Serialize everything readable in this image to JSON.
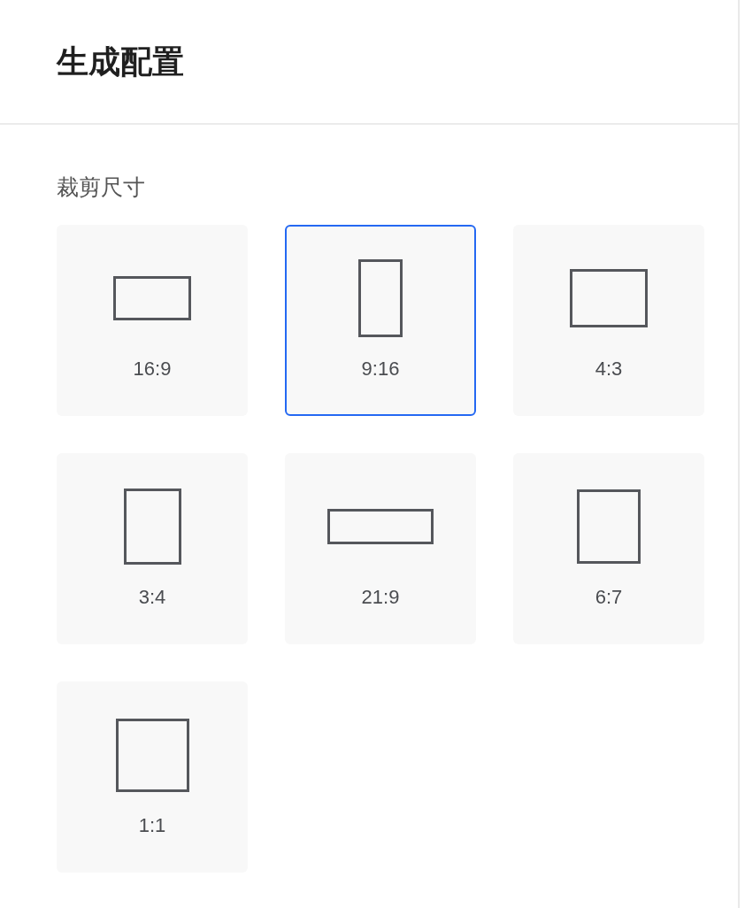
{
  "panel": {
    "title": "生成配置"
  },
  "crop_size": {
    "label": "裁剪尺寸",
    "options": [
      {
        "label": "16:9",
        "selected": false
      },
      {
        "label": "9:16",
        "selected": true
      },
      {
        "label": "4:3",
        "selected": false
      },
      {
        "label": "3:4",
        "selected": false
      },
      {
        "label": "21:9",
        "selected": false
      },
      {
        "label": "6:7",
        "selected": false
      },
      {
        "label": "1:1",
        "selected": false
      }
    ]
  }
}
